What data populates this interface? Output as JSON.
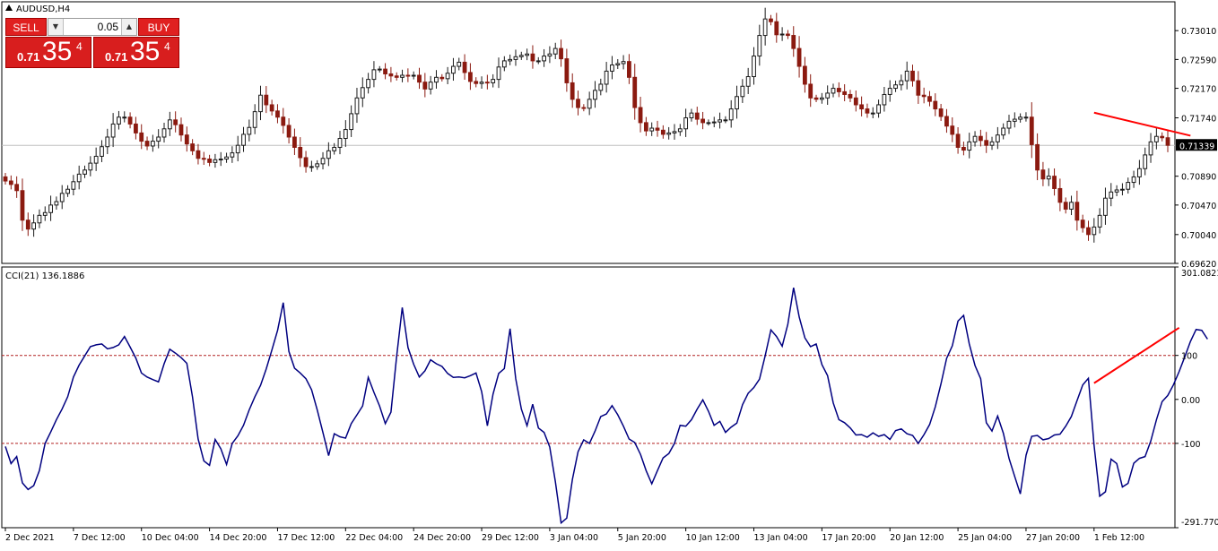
{
  "window": {
    "title": "AUDUSD,H4"
  },
  "trade_widget": {
    "sell_label": "SELL",
    "buy_label": "BUY",
    "lot": "0.05",
    "sell_price": {
      "prefix": "0.71",
      "big": "35",
      "sup": "4"
    },
    "buy_price": {
      "prefix": "0.71",
      "big": "35",
      "sup": "4"
    },
    "button_color": "#e02020"
  },
  "colors": {
    "bull": "#1a1a1a",
    "bear": "#8b1a10",
    "cci_line": "#000080",
    "trendline": "#ff0000",
    "level_line": "#b22222",
    "price_label_bg": "#000000"
  },
  "chart_data": [
    {
      "type": "candlestick",
      "title": "AUDUSD,H4",
      "ylim": [
        0.6962,
        0.7343
      ],
      "y_ticks": [
        "0.73010",
        "0.72590",
        "0.72170",
        "0.71740",
        "0.71339",
        "0.70890",
        "0.70470",
        "0.70040",
        "0.69620"
      ],
      "y_tick_values": [
        0.7301,
        0.7259,
        0.7217,
        0.7174,
        0.71339,
        0.7089,
        0.7047,
        0.7004,
        0.6962
      ],
      "current_price": "0.71339",
      "current_price_value": 0.71339,
      "bar_count": 210,
      "close": [
        0.7082,
        0.7077,
        0.7068,
        0.7025,
        0.7012,
        0.7021,
        0.7032,
        0.7036,
        0.7047,
        0.7052,
        0.7064,
        0.707,
        0.7081,
        0.7092,
        0.7098,
        0.7108,
        0.7118,
        0.7132,
        0.7146,
        0.7165,
        0.7175,
        0.7175,
        0.7165,
        0.7152,
        0.714,
        0.7133,
        0.714,
        0.7146,
        0.7158,
        0.7171,
        0.7164,
        0.7149,
        0.7136,
        0.7126,
        0.7115,
        0.7114,
        0.7109,
        0.7113,
        0.7114,
        0.7117,
        0.7123,
        0.7134,
        0.715,
        0.716,
        0.7183,
        0.7207,
        0.7193,
        0.7184,
        0.7175,
        0.7163,
        0.7146,
        0.7131,
        0.7116,
        0.7103,
        0.7103,
        0.7107,
        0.7115,
        0.7126,
        0.7131,
        0.7144,
        0.7157,
        0.718,
        0.7203,
        0.7218,
        0.723,
        0.7244,
        0.7245,
        0.7238,
        0.7235,
        0.7233,
        0.7236,
        0.7235,
        0.7236,
        0.7226,
        0.7216,
        0.7226,
        0.7233,
        0.7231,
        0.7239,
        0.7249,
        0.7255,
        0.724,
        0.7227,
        0.7224,
        0.7226,
        0.7225,
        0.723,
        0.7248,
        0.7257,
        0.7259,
        0.7263,
        0.7265,
        0.7267,
        0.7257,
        0.7257,
        0.7264,
        0.7267,
        0.7275,
        0.726,
        0.7225,
        0.7201,
        0.7189,
        0.7188,
        0.7201,
        0.7214,
        0.7223,
        0.7242,
        0.7251,
        0.7253,
        0.7256,
        0.7233,
        0.7189,
        0.7167,
        0.7155,
        0.7159,
        0.7156,
        0.715,
        0.7152,
        0.7154,
        0.7158,
        0.7174,
        0.7181,
        0.7172,
        0.7167,
        0.7167,
        0.7168,
        0.7171,
        0.7171,
        0.7187,
        0.7205,
        0.722,
        0.7234,
        0.7264,
        0.7294,
        0.7318,
        0.7314,
        0.7295,
        0.7296,
        0.7294,
        0.7275,
        0.7249,
        0.7223,
        0.7203,
        0.7201,
        0.7203,
        0.721,
        0.7217,
        0.7212,
        0.7208,
        0.7203,
        0.7193,
        0.7187,
        0.7181,
        0.7181,
        0.7193,
        0.7208,
        0.7217,
        0.7222,
        0.7228,
        0.7242,
        0.7228,
        0.7207,
        0.7205,
        0.7198,
        0.7187,
        0.7176,
        0.7162,
        0.715,
        0.7131,
        0.7127,
        0.7139,
        0.7147,
        0.7141,
        0.7134,
        0.7139,
        0.7149,
        0.7159,
        0.7169,
        0.7172,
        0.7175,
        0.7175,
        0.7135,
        0.7098,
        0.7085,
        0.7089,
        0.7071,
        0.7051,
        0.7041,
        0.7051,
        0.7025,
        0.7014,
        0.7004,
        0.7015,
        0.7032,
        0.7057,
        0.7066,
        0.7069,
        0.707,
        0.708,
        0.7088,
        0.71,
        0.712,
        0.7139,
        0.7147,
        0.7145,
        0.7134
      ]
    },
    {
      "type": "line",
      "title": "CCI(21) 136.1886",
      "ylim": [
        -291.7706,
        301.0821
      ],
      "y_ticks": [
        "301.0821",
        "100",
        "0.00",
        "-100",
        "-291.7706"
      ],
      "y_tick_values": [
        301.0821,
        100,
        0,
        -100,
        -291.7706
      ],
      "levels": [
        100,
        -100
      ],
      "series": [
        {
          "values": [
            -107,
            -146,
            -130,
            -190,
            -205,
            -196,
            -162,
            -100,
            -74,
            -46,
            -22,
            6,
            51,
            78,
            99,
            120,
            124,
            126,
            115,
            118,
            124,
            143,
            119,
            94,
            60,
            51,
            45,
            40,
            81,
            114,
            105,
            95,
            82,
            6,
            -90,
            -140,
            -150,
            -91,
            -112,
            -148,
            -100,
            -83,
            -59,
            -24,
            6,
            32,
            69,
            112,
            157,
            220,
            109,
            71,
            60,
            47,
            22,
            -24,
            -75,
            -128,
            -78,
            -85,
            -88,
            -55,
            -35,
            -15,
            50,
            16,
            -15,
            -55,
            -29,
            97,
            209,
            118,
            80,
            51,
            65,
            90,
            81,
            75,
            59,
            50,
            51,
            49,
            54,
            60,
            18,
            -60,
            12,
            59,
            70,
            161,
            47,
            -22,
            -60,
            -11,
            -65,
            -75,
            -108,
            -187,
            -281,
            -270,
            -182,
            -119,
            -92,
            -100,
            -72,
            -39,
            -33,
            -14,
            -35,
            -61,
            -90,
            -98,
            -125,
            -162,
            -192,
            -162,
            -133,
            -123,
            -100,
            -59,
            -61,
            -46,
            -22,
            -1,
            -27,
            -59,
            -50,
            -75,
            -63,
            -54,
            -12,
            14,
            27,
            46,
            99,
            158,
            143,
            121,
            171,
            254,
            187,
            140,
            120,
            126,
            79,
            54,
            -8,
            -46,
            -53,
            -65,
            -81,
            -80,
            -86,
            -76,
            -84,
            -80,
            -91,
            -71,
            -67,
            -78,
            -82,
            -100,
            -80,
            -57,
            -17,
            35,
            93,
            122,
            178,
            191,
            126,
            77,
            47,
            -53,
            -72,
            -38,
            -77,
            -134,
            -175,
            -215,
            -127,
            -84,
            -82,
            -92,
            -89,
            -81,
            -79,
            -61,
            -39,
            -3,
            33,
            48,
            -104,
            -220,
            -210,
            -136,
            -146,
            -199,
            -191,
            -145,
            -134,
            -130,
            -95,
            -46,
            -5,
            9,
            33,
            63,
            97,
            132,
            159,
            157,
            137
          ]
        }
      ]
    }
  ],
  "annotations": [
    {
      "type": "trendline",
      "chart": 0,
      "from": {
        "bar": 192,
        "value": 0.71815
      },
      "to": {
        "bar": 209,
        "value": 0.7148
      }
    },
    {
      "type": "trendline",
      "chart": 1,
      "from": {
        "bar": 192,
        "value": 37
      },
      "to": {
        "bar": 207,
        "value": 163
      }
    }
  ],
  "x_axis": {
    "labels": [
      "2 Dec 2021",
      "7 Dec 12:00",
      "10 Dec 04:00",
      "14 Dec 20:00",
      "17 Dec 12:00",
      "22 Dec 04:00",
      "24 Dec 20:00",
      "29 Dec 12:00",
      "3 Jan 04:00",
      "5 Jan 20:00",
      "10 Jan 12:00",
      "13 Jan 04:00",
      "17 Jan 20:00",
      "20 Jan 12:00",
      "25 Jan 04:00",
      "27 Jan 20:00",
      "1 Feb 12:00"
    ],
    "label_bars": [
      0,
      12,
      24,
      36,
      48,
      60,
      72,
      84,
      96,
      108,
      120,
      132,
      144,
      156,
      168,
      180,
      192
    ]
  }
}
